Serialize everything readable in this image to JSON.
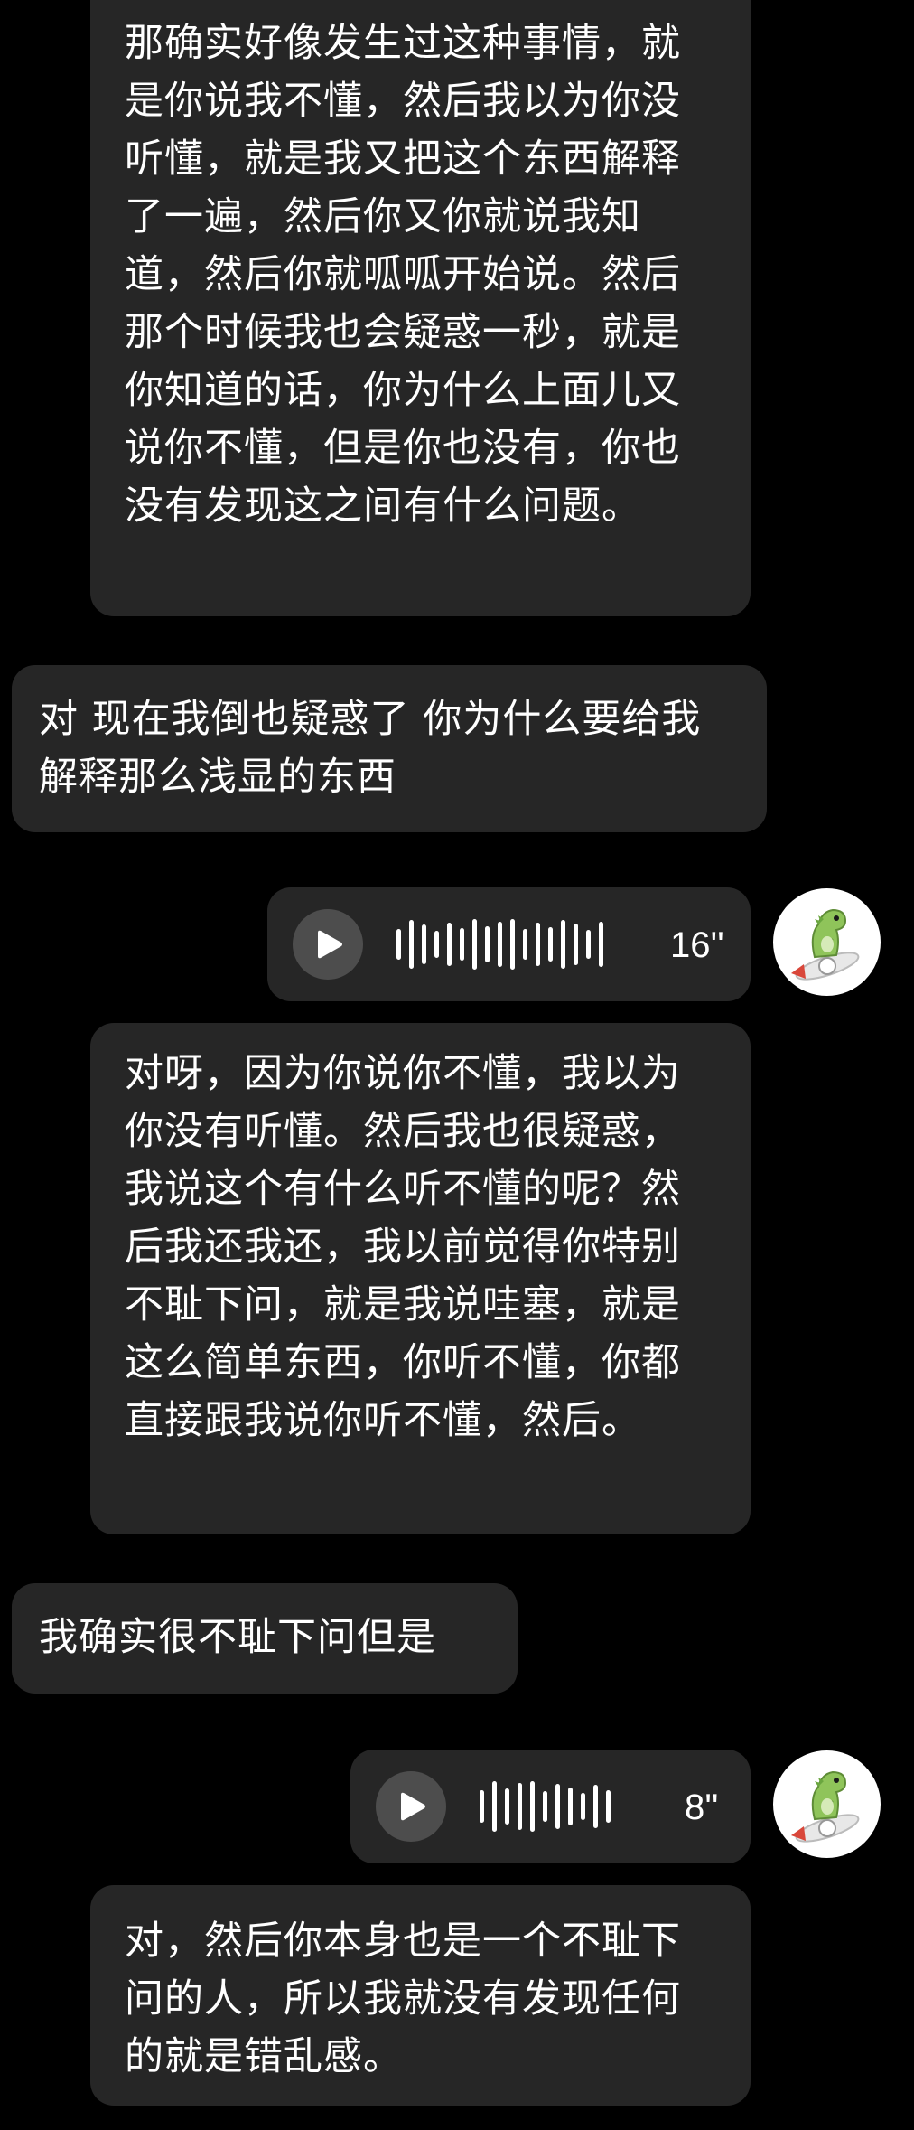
{
  "messages": {
    "transcript1": "那确实好像发生过这种事情，就是你说我不懂，然后我以为你没听懂，就是我又把这个东西解释了一遍，然后你又你就说我知道，然后你就呱呱开始说。然后那个时候我也会疑惑一秒，就是你知道的话，你为什么上面儿又说你不懂，但是你也没有，你也没有发现这之间有什么问题。",
    "incoming1": "对 现在我倒也疑惑了 你为什么要给我解释那么浅显的东西",
    "voice1_duration": "16''",
    "transcript2": "对呀，因为你说你不懂，我以为你没有听懂。然后我也很疑惑，我说这个有什么听不懂的呢？然后我还我还，我以前觉得你特别不耻下问，就是我说哇塞，就是这么简单东西，你听不懂，你都直接跟我说你听不懂，然后。",
    "incoming2": "我确实很不耻下问但是",
    "voice2_duration": "8''",
    "transcript3": "对，然后你本身也是一个不耻下问的人，所以我就没有发现任何的就是错乱感。"
  },
  "colors": {
    "background": "#000000",
    "bubble": "#262626",
    "play_button": "#4d4d4d",
    "avatar_bg": "#ffffff",
    "dino_green": "#8fc45a",
    "rocket_red": "#d9473a"
  },
  "icons": {
    "play": "play-icon",
    "avatar": "dinosaur-rocket-avatar"
  }
}
